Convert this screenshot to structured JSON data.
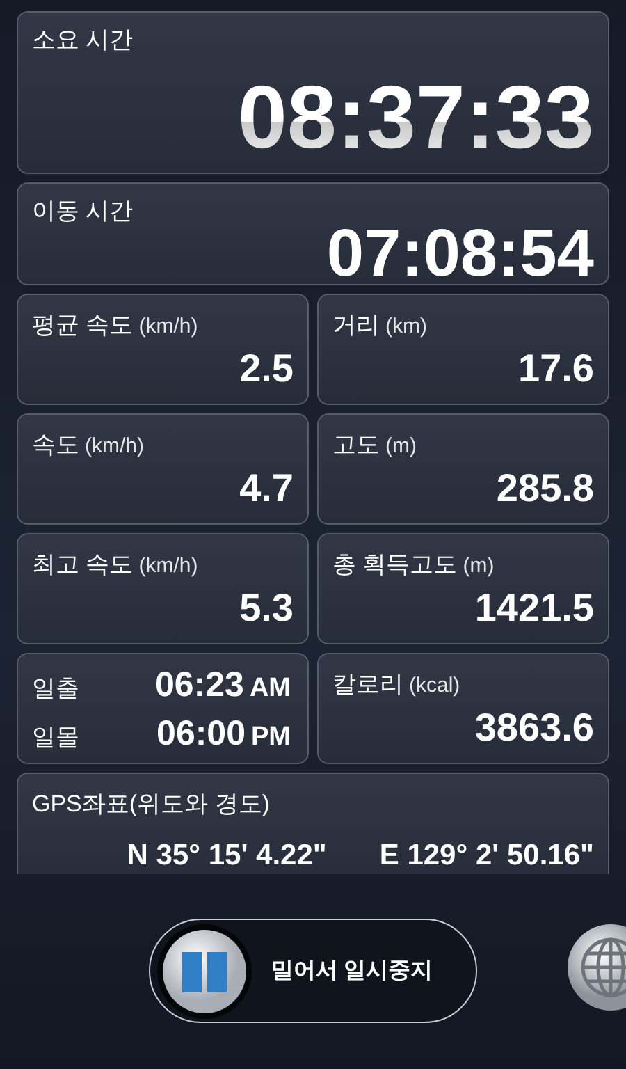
{
  "elapsed": {
    "label": "소요 시간",
    "value": "08:37:33"
  },
  "moving": {
    "label": "이동 시간",
    "value": "07:08:54"
  },
  "cells": [
    {
      "kind": "stat",
      "label": "평균 속도",
      "unit": "(km/h)",
      "value": "2.5"
    },
    {
      "kind": "stat",
      "label": "거리",
      "unit": "(km)",
      "value": "17.6"
    },
    {
      "kind": "stat",
      "label": "속도",
      "unit": "(km/h)",
      "value": "4.7"
    },
    {
      "kind": "stat",
      "label": "고도",
      "unit": "(m)",
      "value": "285.8"
    },
    {
      "kind": "stat",
      "label": "최고 속도",
      "unit": "(km/h)",
      "value": "5.3"
    },
    {
      "kind": "stat",
      "label": "총 획득고도",
      "unit": "(m)",
      "value": "1421.5"
    },
    {
      "kind": "sun",
      "rows": [
        {
          "label": "일출",
          "time": "06:23",
          "period": "AM"
        },
        {
          "label": "일몰",
          "time": "06:00",
          "period": "PM"
        }
      ]
    },
    {
      "kind": "stat",
      "label": "칼로리",
      "unit": "(kcal)",
      "value": "3863.6"
    }
  ],
  "gps": {
    "label": "GPS좌표(위도와 경도)",
    "latitude": "N 35° 15' 4.22\"",
    "longitude": "E 129° 2' 50.16\""
  },
  "slider": {
    "label": "밀어서 일시중지",
    "level": 0
  }
}
